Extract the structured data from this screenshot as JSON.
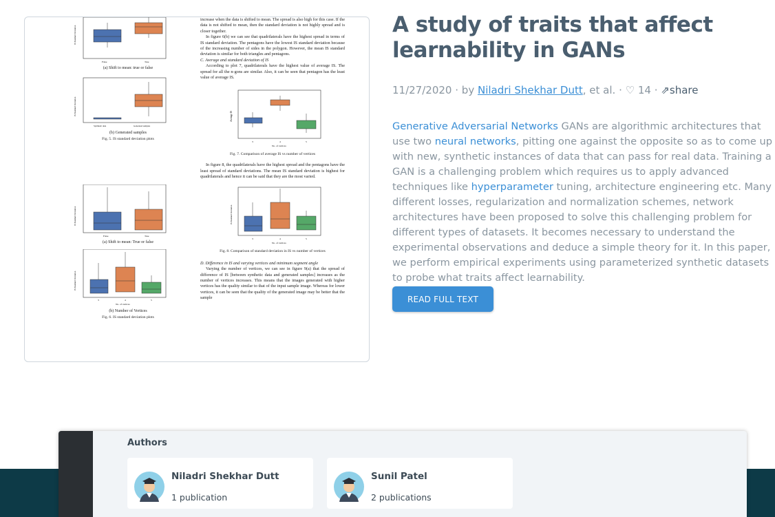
{
  "paper": {
    "title": "A study of traits that affect learnability in GANs",
    "date": "11/27/2020",
    "by": "by",
    "author": "Niladri Shekhar Dutt",
    "etal": ", et al.",
    "likes": "14",
    "share": "share",
    "abstract": {
      "p1_link": "Generative Adversarial Networks",
      "p1_text": " GANs are algorithmic architectures that use two ",
      "p2_link": "neural networks",
      "p2_text": ", pitting one against the opposite so as to come up with new, synthetic instances of data that can pass for real data. Training a GAN is a challenging problem which requires us to apply advanced techniques like ",
      "p3_link": "hyperparameter",
      "p3_text": " tuning, architecture engineering etc. Many different losses, regularization and normalization schemes, network architectures have been proposed to solve this challenging problem for different types of datasets. It becomes necessary to understand the experimental observations and deduce a simple theory for it. In this paper, we perform empirical experiments using parameterized synthetic datasets to probe what traits affect learnability."
    },
    "read_button": "READ FULL TEXT"
  },
  "preview": {
    "cap_a1": "(a) Shift to mean: true or false",
    "cap_b1": "(b) Generated samples",
    "fig5": "Fig. 5.   IS standard deviation plots",
    "cap_a2": "(a) Shift to mean: True or false",
    "cap_b2": "(b) Number of Vertices",
    "fig6": "Fig. 6.   IS standard deviation plots",
    "right_p1": "increase when the data is shifted to mean. The spread is also high for this case. If the data is not shifted to mean, then the standard deviation is not highly spread and is closer together.",
    "right_p2": "In figure 6(b) we can see that quadrilaterals have the highest spread in terms of IS standard deviation. The pentagons have the lowest IS standard deviation because of the increasing number of sides in the polygon. However, the mean IS standard deviation is similar for both triangles and pentagons.",
    "sec_c": "C.  Average and standard deviation of IS",
    "right_p3": "According to plot 7, quadrilaterals have the highest value of average IS. The spread for all the n-gons are similar. Also, it can be seen that pentagon has the least value of average IS.",
    "fig7": "Fig. 7.   Comparison of average IS vs number of vertices",
    "right_p4": "In figure 8, the quadrilaterals have the highest spread and the pentagons have the least spread of standard deviations. The mean IS standard deviation is highest for quadrilaterals and hence it can be said that they are the most varied.",
    "fig8": "Fig. 8.   Comparison of standard deviation in IS vs number of vertices",
    "sec_d": "D.  Difference in IS and varying vertices and minimum segment angle",
    "right_p5": "Varying the number of vertices, we can see in figure 9(a) that the spread of difference of IS [between synthetic data and generated samples] increases as the number of vertices increases. This means that the images generated with higher vertices has the quality similar to that of the input sample image. Whereas for lower vertices, it can be seen that the quality of the generated image may be better that the sample",
    "xt_false": "False",
    "xt_true": "True",
    "xt_synth": "Synthetic data",
    "xt_gen": "Generated samples",
    "xt_3": "3",
    "xt_4": "4",
    "xt_5": "5",
    "xlab_vert": "No. of vertices",
    "ylab_std": "IS Standard Deviation",
    "ylab_avg": "Average IS"
  },
  "authors": {
    "heading": "Authors",
    "list": [
      {
        "name": "Niladri Shekhar Dutt",
        "pubs": "1 publication"
      },
      {
        "name": "Sunil Patel",
        "pubs": "2 publications"
      }
    ]
  },
  "colors": {
    "link": "#3b8fd6",
    "title": "#4a5e6f",
    "body_text": "#8a96a0",
    "footer": "#0d3a47",
    "box_blue": "#4c72b0",
    "box_orange": "#dd8452",
    "box_green": "#55a868"
  }
}
